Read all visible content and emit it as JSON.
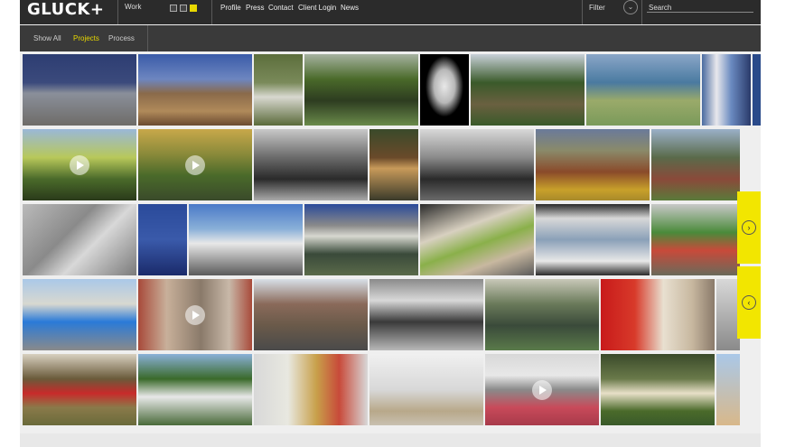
{
  "logo": "GLUCK+",
  "nav": {
    "work_label": "Work",
    "links": [
      "Profile",
      "Press",
      "Contact",
      "Client Login",
      "News"
    ],
    "filter_label": "Filter",
    "search_placeholder": "Search"
  },
  "subnav": {
    "items": [
      "Show All",
      "Projects",
      "Process"
    ],
    "active": "Projects"
  },
  "colors": {
    "accent": "#e8d800",
    "topbar": "#2b2b2b",
    "subbar": "#3a3a3a"
  },
  "icons": {
    "filter": "chevron-down-icon",
    "side_next": "chevron-right-icon",
    "side_prev": "chevron-left-icon",
    "video": "play-icon"
  }
}
